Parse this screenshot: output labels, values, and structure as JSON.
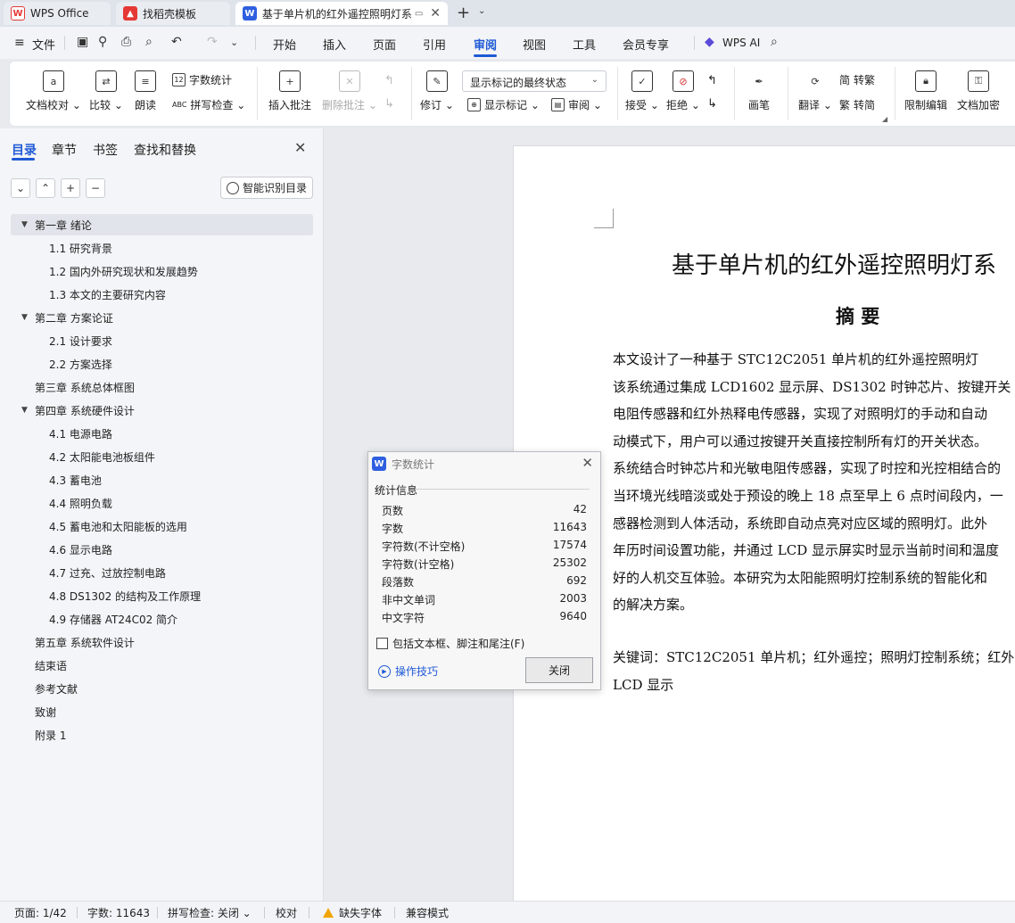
{
  "tabs": {
    "wps": "WPS Office",
    "template": "找稻壳模板",
    "doc": "基于单片机的红外遥控照明灯系",
    "plus": "+",
    "more": "⌄"
  },
  "menu": {
    "file": "文件",
    "items": [
      "开始",
      "插入",
      "页面",
      "引用",
      "审阅",
      "视图",
      "工具",
      "会员专享"
    ],
    "active": "审阅",
    "ai": "WPS AI"
  },
  "ribbon": {
    "doc_check": "文档校对",
    "compare": "比较",
    "read_aloud": "朗读",
    "word_count": "字数统计",
    "spell_check": "拼写检查",
    "insert_comment": "插入批注",
    "delete_comment": "删除批注",
    "revise": "修订",
    "markup_dropdown": "显示标记的最终状态",
    "show_markup": "显示标记",
    "review": "审阅",
    "accept": "接受",
    "reject": "拒绝",
    "pen": "画笔",
    "translate": "翻译",
    "to_traditional": "转繁",
    "to_simplified": "转简",
    "restrict_edit": "限制编辑",
    "encrypt": "文档加密"
  },
  "nav": {
    "tabs": [
      "目录",
      "章节",
      "书签",
      "查找和替换"
    ],
    "smart_toc": "智能识别目录",
    "toc": [
      {
        "label": "第一章  绪论",
        "level": 1,
        "expand": true,
        "selected": true
      },
      {
        "label": "1.1 研究背景",
        "level": 2
      },
      {
        "label": "1.2 国内外研究现状和发展趋势",
        "level": 2
      },
      {
        "label": "1.3 本文的主要研究内容",
        "level": 2
      },
      {
        "label": "第二章  方案论证",
        "level": 1,
        "expand": true
      },
      {
        "label": "2.1  设计要求",
        "level": 2
      },
      {
        "label": "2.2  方案选择",
        "level": 2
      },
      {
        "label": "第三章  系统总体框图",
        "level": 1
      },
      {
        "label": "第四章  系统硬件设计",
        "level": 1,
        "expand": true
      },
      {
        "label": "4.1  电源电路",
        "level": 2
      },
      {
        "label": "4.2  太阳能电池板组件",
        "level": 2
      },
      {
        "label": "4.3  蓄电池",
        "level": 2
      },
      {
        "label": "4.4  照明负载",
        "level": 2
      },
      {
        "label": "4.5  蓄电池和太阳能板的选用",
        "level": 2
      },
      {
        "label": "4.6  显示电路",
        "level": 2
      },
      {
        "label": "4.7  过充、过放控制电路",
        "level": 2
      },
      {
        "label": "4.8 DS1302 的结构及工作原理",
        "level": 2
      },
      {
        "label": "4.9  存储器 AT24C02 简介",
        "level": 2
      },
      {
        "label": "第五章  系统软件设计",
        "level": 1
      },
      {
        "label": "结束语",
        "level": 1
      },
      {
        "label": "参考文献",
        "level": 1
      },
      {
        "label": "致谢",
        "level": 1
      },
      {
        "label": "附录 1",
        "level": 1
      }
    ]
  },
  "document": {
    "title": "基于单片机的红外遥控照明灯系",
    "abstract_heading": "摘  要",
    "lines": [
      "    本文设计了一种基于 STC12C2051 单片机的红外遥控照明灯",
      "该系统通过集成 LCD1602 显示屏、DS1302 时钟芯片、按键开关",
      "电阻传感器和红外热释电传感器，实现了对照明灯的手动和自动",
      "动模式下，用户可以通过按键开关直接控制所有灯的开关状态。",
      "系统结合时钟芯片和光敏电阻传感器，实现了时控和光控相结合的",
      "当环境光线暗淡或处于预设的晚上 18 点至早上 6 点时间段内，一",
      "感器检测到人体活动，系统即自动点亮对应区域的照明灯。此外",
      "年历时间设置功能，并通过 LCD 显示屏实时显示当前时间和温度",
      "好的人机交互体验。本研究为太阳能照明灯控制系统的智能化和",
      "的解决方案。"
    ],
    "keywords_line1": "关键词：STC12C2051 单片机；红外遥控；照明灯控制系统；红外",
    "keywords_line2": "LCD 显示"
  },
  "dialog": {
    "title": "字数统计",
    "section": "统计信息",
    "stats": [
      {
        "label": "页数",
        "value": "42"
      },
      {
        "label": "字数",
        "value": "11643"
      },
      {
        "label": "字符数(不计空格)",
        "value": "17574"
      },
      {
        "label": "字符数(计空格)",
        "value": "25302"
      },
      {
        "label": "段落数",
        "value": "692"
      },
      {
        "label": "非中文单词",
        "value": "2003"
      },
      {
        "label": "中文字符",
        "value": "9640"
      }
    ],
    "checkbox": "包括文本框、脚注和尾注(F)",
    "checkbox_checked": false,
    "tips": "操作技巧",
    "close": "关闭"
  },
  "status": {
    "page": "页面: 1/42",
    "words": "字数: 11643",
    "spell": "拼写检查: 关闭",
    "proof": "校对",
    "missing_font": "缺失字体",
    "compat": "兼容模式"
  },
  "colors": {
    "accent": "#1f5ad6",
    "wps_red": "#e53935",
    "doc_blue": "#2f5fe0"
  }
}
